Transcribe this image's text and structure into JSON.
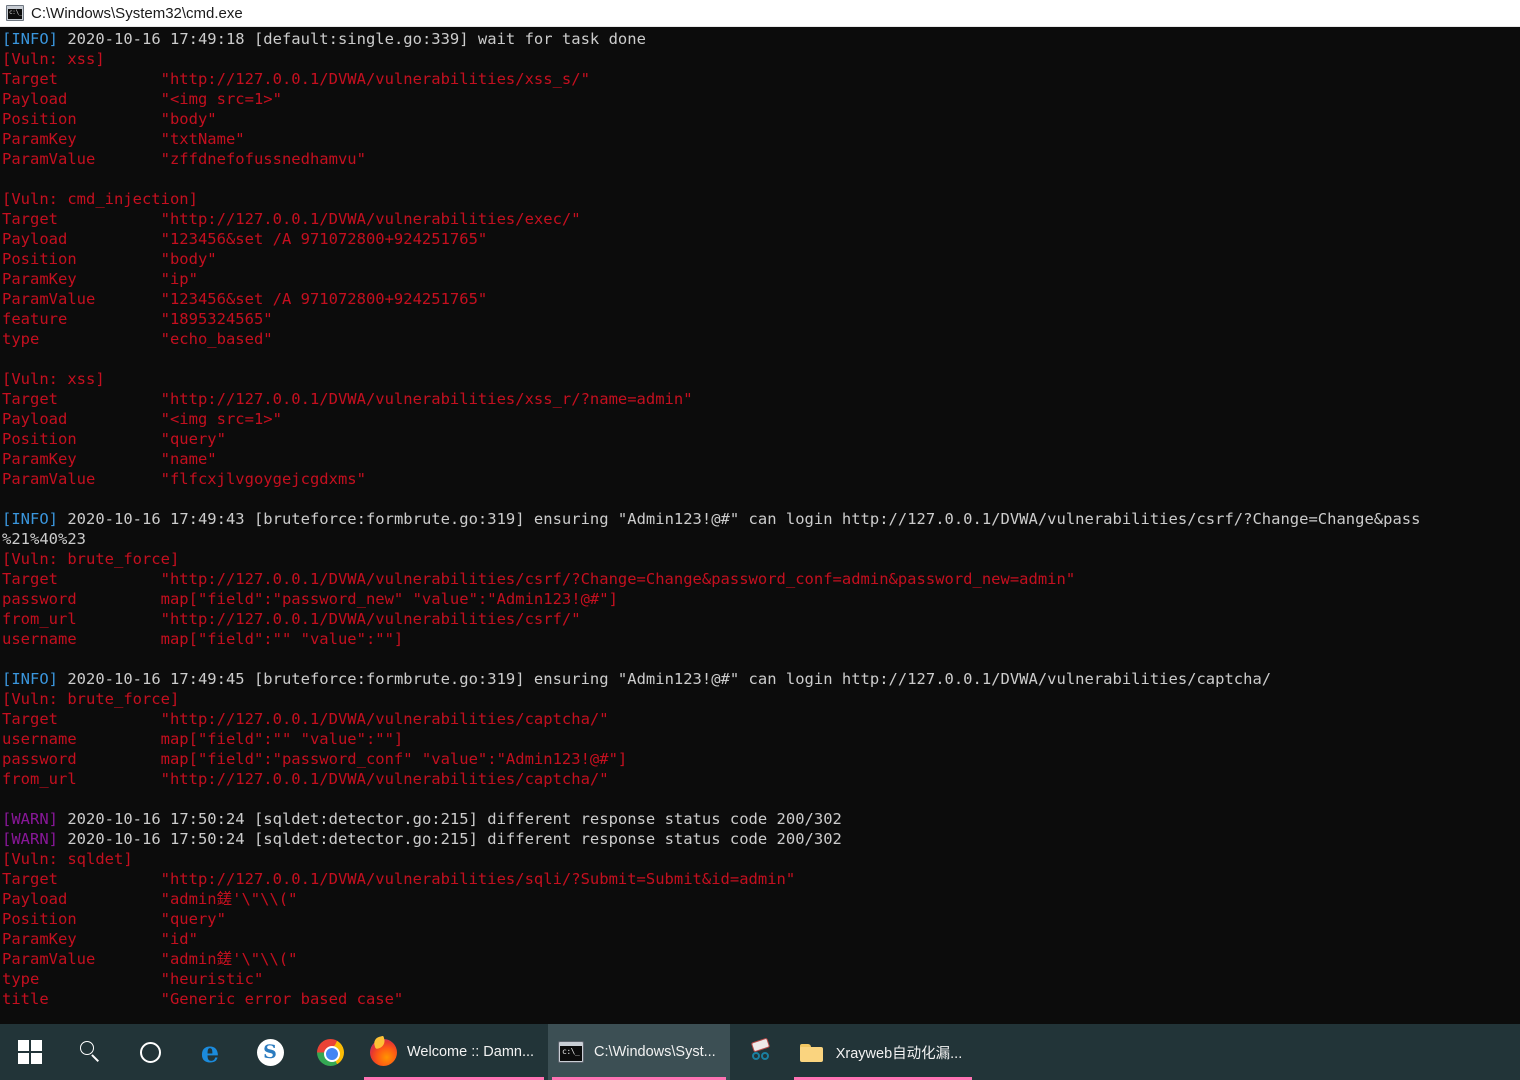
{
  "window": {
    "title": "C:\\Windows\\System32\\cmd.exe",
    "icon": "cmd-icon",
    "background": "#0c0c0c",
    "titlebar_background": "#ffffff"
  },
  "colors": {
    "info_tag": "#3a96dd",
    "warn_tag": "#881798",
    "plain_text": "#cccccc",
    "vuln_text": "#c50f1f",
    "taskbar": "#223438",
    "taskbar_active": "#3c4f54",
    "taskbar_indicator": "#ff73b3"
  },
  "console": {
    "lines": [
      {
        "type": "log",
        "tag": "[INFO]",
        "tag_level": "info",
        "rest": " 2020-10-16 17:49:18 [default:single.go:339] wait for task done"
      },
      {
        "type": "vuln",
        "text": "[Vuln: xss]"
      },
      {
        "type": "vuln",
        "text": "Target           \"http://127.0.0.1/DVWA/vulnerabilities/xss_s/\""
      },
      {
        "type": "vuln",
        "text": "Payload          \"<img src=1>\""
      },
      {
        "type": "vuln",
        "text": "Position         \"body\""
      },
      {
        "type": "vuln",
        "text": "ParamKey         \"txtName\""
      },
      {
        "type": "vuln",
        "text": "ParamValue       \"zffdnefofussnedhamvu\""
      },
      {
        "type": "blank",
        "text": ""
      },
      {
        "type": "vuln",
        "text": "[Vuln: cmd_injection]"
      },
      {
        "type": "vuln",
        "text": "Target           \"http://127.0.0.1/DVWA/vulnerabilities/exec/\""
      },
      {
        "type": "vuln",
        "text": "Payload          \"123456&set /A 971072800+924251765\""
      },
      {
        "type": "vuln",
        "text": "Position         \"body\""
      },
      {
        "type": "vuln",
        "text": "ParamKey         \"ip\""
      },
      {
        "type": "vuln",
        "text": "ParamValue       \"123456&set /A 971072800+924251765\""
      },
      {
        "type": "vuln",
        "text": "feature          \"1895324565\""
      },
      {
        "type": "vuln",
        "text": "type             \"echo_based\""
      },
      {
        "type": "blank",
        "text": ""
      },
      {
        "type": "vuln",
        "text": "[Vuln: xss]"
      },
      {
        "type": "vuln",
        "text": "Target           \"http://127.0.0.1/DVWA/vulnerabilities/xss_r/?name=admin\""
      },
      {
        "type": "vuln",
        "text": "Payload          \"<img src=1>\""
      },
      {
        "type": "vuln",
        "text": "Position         \"query\""
      },
      {
        "type": "vuln",
        "text": "ParamKey         \"name\""
      },
      {
        "type": "vuln",
        "text": "ParamValue       \"flfcxjlvgoygejcgdxms\""
      },
      {
        "type": "blank",
        "text": ""
      },
      {
        "type": "log",
        "tag": "[INFO]",
        "tag_level": "info",
        "rest": " 2020-10-16 17:49:43 [bruteforce:formbrute.go:319] ensuring \"Admin123!@#\" can login http://127.0.0.1/DVWA/vulnerabilities/csrf/?Change=Change&pass"
      },
      {
        "type": "plain",
        "text": "%21%40%23"
      },
      {
        "type": "vuln",
        "text": "[Vuln: brute_force]"
      },
      {
        "type": "vuln",
        "text": "Target           \"http://127.0.0.1/DVWA/vulnerabilities/csrf/?Change=Change&password_conf=admin&password_new=admin\""
      },
      {
        "type": "vuln",
        "text": "password         map[\"field\":\"password_new\" \"value\":\"Admin123!@#\"]"
      },
      {
        "type": "vuln",
        "text": "from_url         \"http://127.0.0.1/DVWA/vulnerabilities/csrf/\""
      },
      {
        "type": "vuln",
        "text": "username         map[\"field\":\"\" \"value\":\"\"]"
      },
      {
        "type": "blank",
        "text": ""
      },
      {
        "type": "log",
        "tag": "[INFO]",
        "tag_level": "info",
        "rest": " 2020-10-16 17:49:45 [bruteforce:formbrute.go:319] ensuring \"Admin123!@#\" can login http://127.0.0.1/DVWA/vulnerabilities/captcha/"
      },
      {
        "type": "vuln",
        "text": "[Vuln: brute_force]"
      },
      {
        "type": "vuln",
        "text": "Target           \"http://127.0.0.1/DVWA/vulnerabilities/captcha/\""
      },
      {
        "type": "vuln",
        "text": "username         map[\"field\":\"\" \"value\":\"\"]"
      },
      {
        "type": "vuln",
        "text": "password         map[\"field\":\"password_conf\" \"value\":\"Admin123!@#\"]"
      },
      {
        "type": "vuln",
        "text": "from_url         \"http://127.0.0.1/DVWA/vulnerabilities/captcha/\""
      },
      {
        "type": "blank",
        "text": ""
      },
      {
        "type": "log",
        "tag": "[WARN]",
        "tag_level": "warn",
        "rest": " 2020-10-16 17:50:24 [sqldet:detector.go:215] different response status code 200/302"
      },
      {
        "type": "log",
        "tag": "[WARN]",
        "tag_level": "warn",
        "rest": " 2020-10-16 17:50:24 [sqldet:detector.go:215] different response status code 200/302"
      },
      {
        "type": "vuln",
        "text": "[Vuln: sqldet]"
      },
      {
        "type": "vuln",
        "text": "Target           \"http://127.0.0.1/DVWA/vulnerabilities/sqli/?Submit=Submit&id=admin\""
      },
      {
        "type": "vuln",
        "text": "Payload          \"admin鎈'\\\"\\\\(\""
      },
      {
        "type": "vuln",
        "text": "Position         \"query\""
      },
      {
        "type": "vuln",
        "text": "ParamKey         \"id\""
      },
      {
        "type": "vuln",
        "text": "ParamValue       \"admin鎈'\\\"\\\\(\""
      },
      {
        "type": "vuln",
        "text": "type             \"heuristic\""
      },
      {
        "type": "vuln",
        "text": "title            \"Generic error based case\""
      }
    ]
  },
  "taskbar": {
    "items": [
      {
        "id": "start",
        "icon": "windows-logo-icon",
        "label": "",
        "active": false,
        "indicator": false
      },
      {
        "id": "search",
        "icon": "search-icon",
        "label": "",
        "active": false,
        "indicator": false
      },
      {
        "id": "cortana",
        "icon": "cortana-ring-icon",
        "label": "",
        "active": false,
        "indicator": false
      },
      {
        "id": "edge",
        "icon": "edge-icon",
        "label": "",
        "active": false,
        "indicator": false
      },
      {
        "id": "sogou",
        "icon": "sogou-icon",
        "label": "",
        "active": false,
        "indicator": false
      },
      {
        "id": "chrome",
        "icon": "chrome-icon",
        "label": "",
        "active": false,
        "indicator": false
      },
      {
        "id": "firefox",
        "icon": "firefox-icon",
        "label": "Welcome :: Damn...",
        "active": false,
        "indicator": true
      },
      {
        "id": "cmd",
        "icon": "cmd-icon",
        "label": "C:\\Windows\\Syst...",
        "active": true,
        "indicator": true
      },
      {
        "id": "snippingtool",
        "icon": "scissors-icon",
        "label": "",
        "active": false,
        "indicator": false
      },
      {
        "id": "explorer",
        "icon": "folder-icon",
        "label": "Xrayweb自动化漏...",
        "active": false,
        "indicator": true
      }
    ]
  }
}
